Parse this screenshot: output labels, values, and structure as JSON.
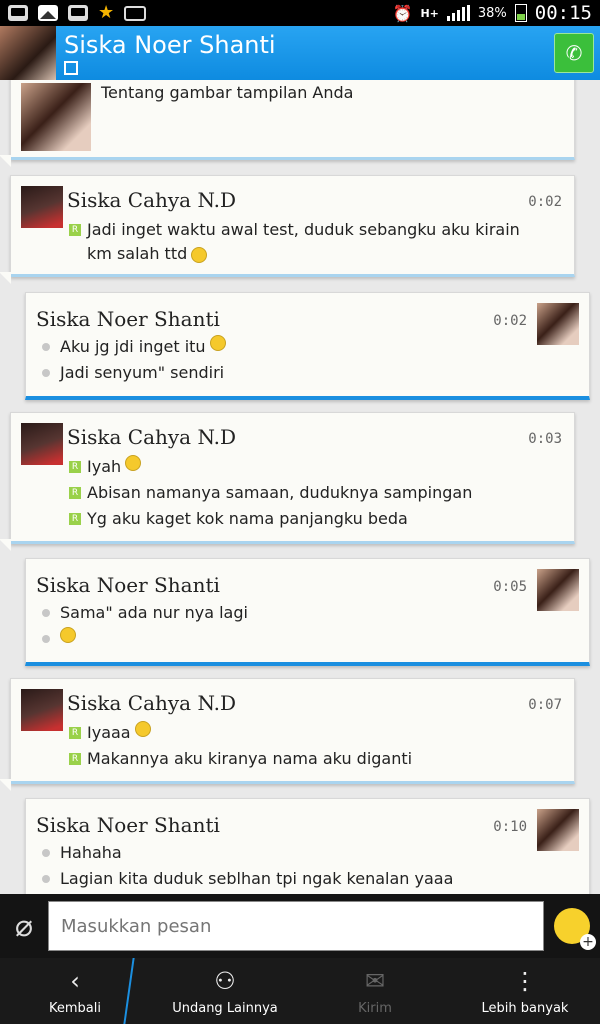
{
  "status_bar": {
    "battery": "38%",
    "time": "00:15",
    "network": "H+"
  },
  "header": {
    "title": "Siska Noer Shanti"
  },
  "messages": [
    {
      "direction": "in",
      "partial": true,
      "lines": [
        "Tentang gambar tampilan Anda"
      ]
    },
    {
      "direction": "in",
      "sender": "Siska Cahya N.D",
      "time": "0:02",
      "lines": [
        "Jadi inget waktu awal test, duduk sebangku aku kirain km salah ttd"
      ]
    },
    {
      "direction": "out",
      "sender": "Siska Noer Shanti",
      "time": "0:02",
      "lines": [
        "Aku jg jdi inget itu",
        "Jadi senyum\" sendiri"
      ]
    },
    {
      "direction": "in",
      "sender": "Siska Cahya N.D",
      "time": "0:03",
      "lines": [
        "Iyah",
        "Abisan namanya samaan, duduknya sampingan",
        "Yg aku kaget kok nama panjangku beda"
      ]
    },
    {
      "direction": "out",
      "sender": "Siska Noer Shanti",
      "time": "0:05",
      "lines": [
        "Sama\" ada nur nya lagi",
        ""
      ]
    },
    {
      "direction": "in",
      "sender": "Siska Cahya N.D",
      "time": "0:07",
      "lines": [
        "Iyaaa",
        "Makannya aku kiranya nama aku diganti"
      ]
    },
    {
      "direction": "out",
      "sender": "Siska Noer Shanti",
      "time": "0:10",
      "lines": [
        "Hahaha",
        "Lagian kita duduk seblhan tpi ngak kenalan yaaa"
      ]
    }
  ],
  "input": {
    "placeholder": "Masukkan pesan"
  },
  "nav": {
    "back": "Kembali",
    "invite": "Undang Lainnya",
    "send": "Kirim",
    "more": "Lebih banyak"
  },
  "colors": {
    "header": "#1a96e8",
    "accent": "#1b8fe0",
    "call": "#3bbf3b"
  }
}
